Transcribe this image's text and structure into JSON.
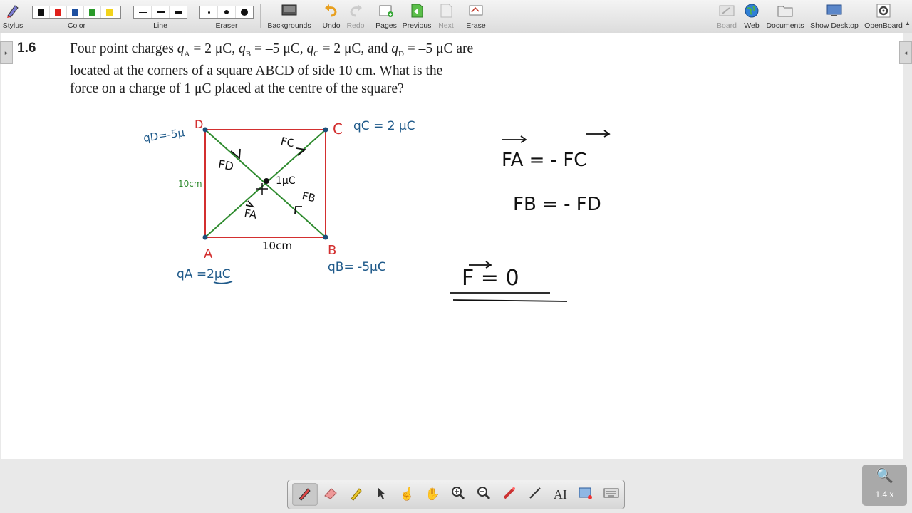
{
  "toolbar": {
    "left": {
      "stylus": "Stylus",
      "color": "Color",
      "line": "Line",
      "eraser": "Eraser",
      "backgrounds": "Backgrounds",
      "undo": "Undo",
      "redo": "Redo",
      "pages": "Pages",
      "previous": "Previous",
      "next": "Next",
      "erase": "Erase"
    },
    "right": {
      "board": "Board",
      "web": "Web",
      "documents": "Documents",
      "show_desktop": "Show Desktop",
      "openboard": "OpenBoard"
    },
    "colors": [
      "#111111",
      "#e0201b",
      "#1d4fa0",
      "#2a9a2a",
      "#f2d31b"
    ]
  },
  "problem": {
    "number": "1.6",
    "line1_a": "Four point charges ",
    "q": "q",
    "sub_a": "A",
    "sub_b": "B",
    "sub_c": "C",
    "sub_d": "D",
    "val_a": " = 2 μC, ",
    "val_b": " = –5 μC, ",
    "val_c": " = 2 μC, and ",
    "val_d": " = –5 μC are",
    "line2": "located at the corners of a square ABCD of side 10 cm. What is the",
    "line3": "force on a charge of 1 μC placed at the centre of the square?"
  },
  "annotations": {
    "corner_a": "A",
    "corner_b": "B",
    "corner_c": "C",
    "corner_d": "D",
    "q_d": "qD=-5μ",
    "q_c": "qC = 2 μC",
    "q_a": "qA =2μC",
    "q_b": "qB= -5μC",
    "side_left": "10cm",
    "side_bottom": "10cm",
    "center_charge": "1μC",
    "f_d": "FD",
    "f_c": "FC",
    "f_a": "FA",
    "f_b": "FB",
    "eq1": "FA  = - FC",
    "eq2": "FB   = - FD",
    "eq3": "F  =  0"
  },
  "bottom_tools": [
    "pen-icon",
    "eraser-icon",
    "highlighter-icon",
    "pointer-icon",
    "hand-pointer-icon",
    "hand-icon",
    "zoom-in-icon",
    "zoom-out-icon",
    "laser-icon",
    "line-icon",
    "text-icon",
    "capture-icon",
    "keyboard-icon"
  ],
  "zoom": {
    "level": "1.4 x"
  }
}
